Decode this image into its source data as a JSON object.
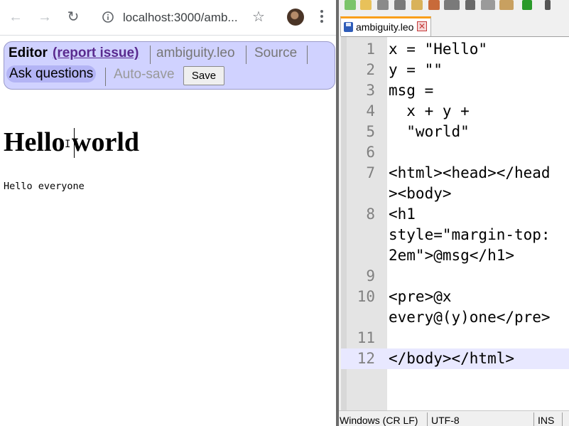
{
  "browser": {
    "url": "localhost:3000/amb...",
    "icons": {
      "back": "arrow-left-icon",
      "forward": "arrow-right-icon",
      "reload": "reload-icon",
      "info": "info-icon",
      "star": "star-icon",
      "menu": "kebab-menu-icon"
    }
  },
  "editor_bar": {
    "title": "Editor",
    "report_link": "(report issue)",
    "filename": "ambiguity.leo",
    "source": "Source",
    "ask": "Ask questions",
    "autosave": "Auto-save",
    "save": "Save",
    "background": "#d0d2ff"
  },
  "page": {
    "heading": "Hello world",
    "pre": "Hello everyone"
  },
  "npp": {
    "tab_label": "ambiguity.leo",
    "tab_accent": "#fa9f1a",
    "lines": [
      {
        "n": "1",
        "rows": [
          "x = \"Hello\""
        ]
      },
      {
        "n": "2",
        "rows": [
          "y = \"\""
        ]
      },
      {
        "n": "3",
        "rows": [
          "msg ="
        ]
      },
      {
        "n": "4",
        "rows": [
          "  x + y +"
        ]
      },
      {
        "n": "5",
        "rows": [
          "  \"world\""
        ]
      },
      {
        "n": "6",
        "rows": [
          ""
        ]
      },
      {
        "n": "7",
        "rows": [
          "<html><head></head",
          "><body>"
        ]
      },
      {
        "n": "8",
        "rows": [
          "<h1",
          "style=\"margin-top:",
          "2em\">@msg</h1>"
        ]
      },
      {
        "n": "9",
        "rows": [
          ""
        ]
      },
      {
        "n": "10",
        "rows": [
          "<pre>@x",
          "every@(y)one</pre>"
        ]
      },
      {
        "n": "11",
        "rows": [
          ""
        ]
      },
      {
        "n": "12",
        "rows": [
          "</body></html>"
        ],
        "current": true
      }
    ],
    "status": {
      "eol": "Windows (CR LF)",
      "encoding": "UTF-8",
      "mode": "INS"
    }
  }
}
